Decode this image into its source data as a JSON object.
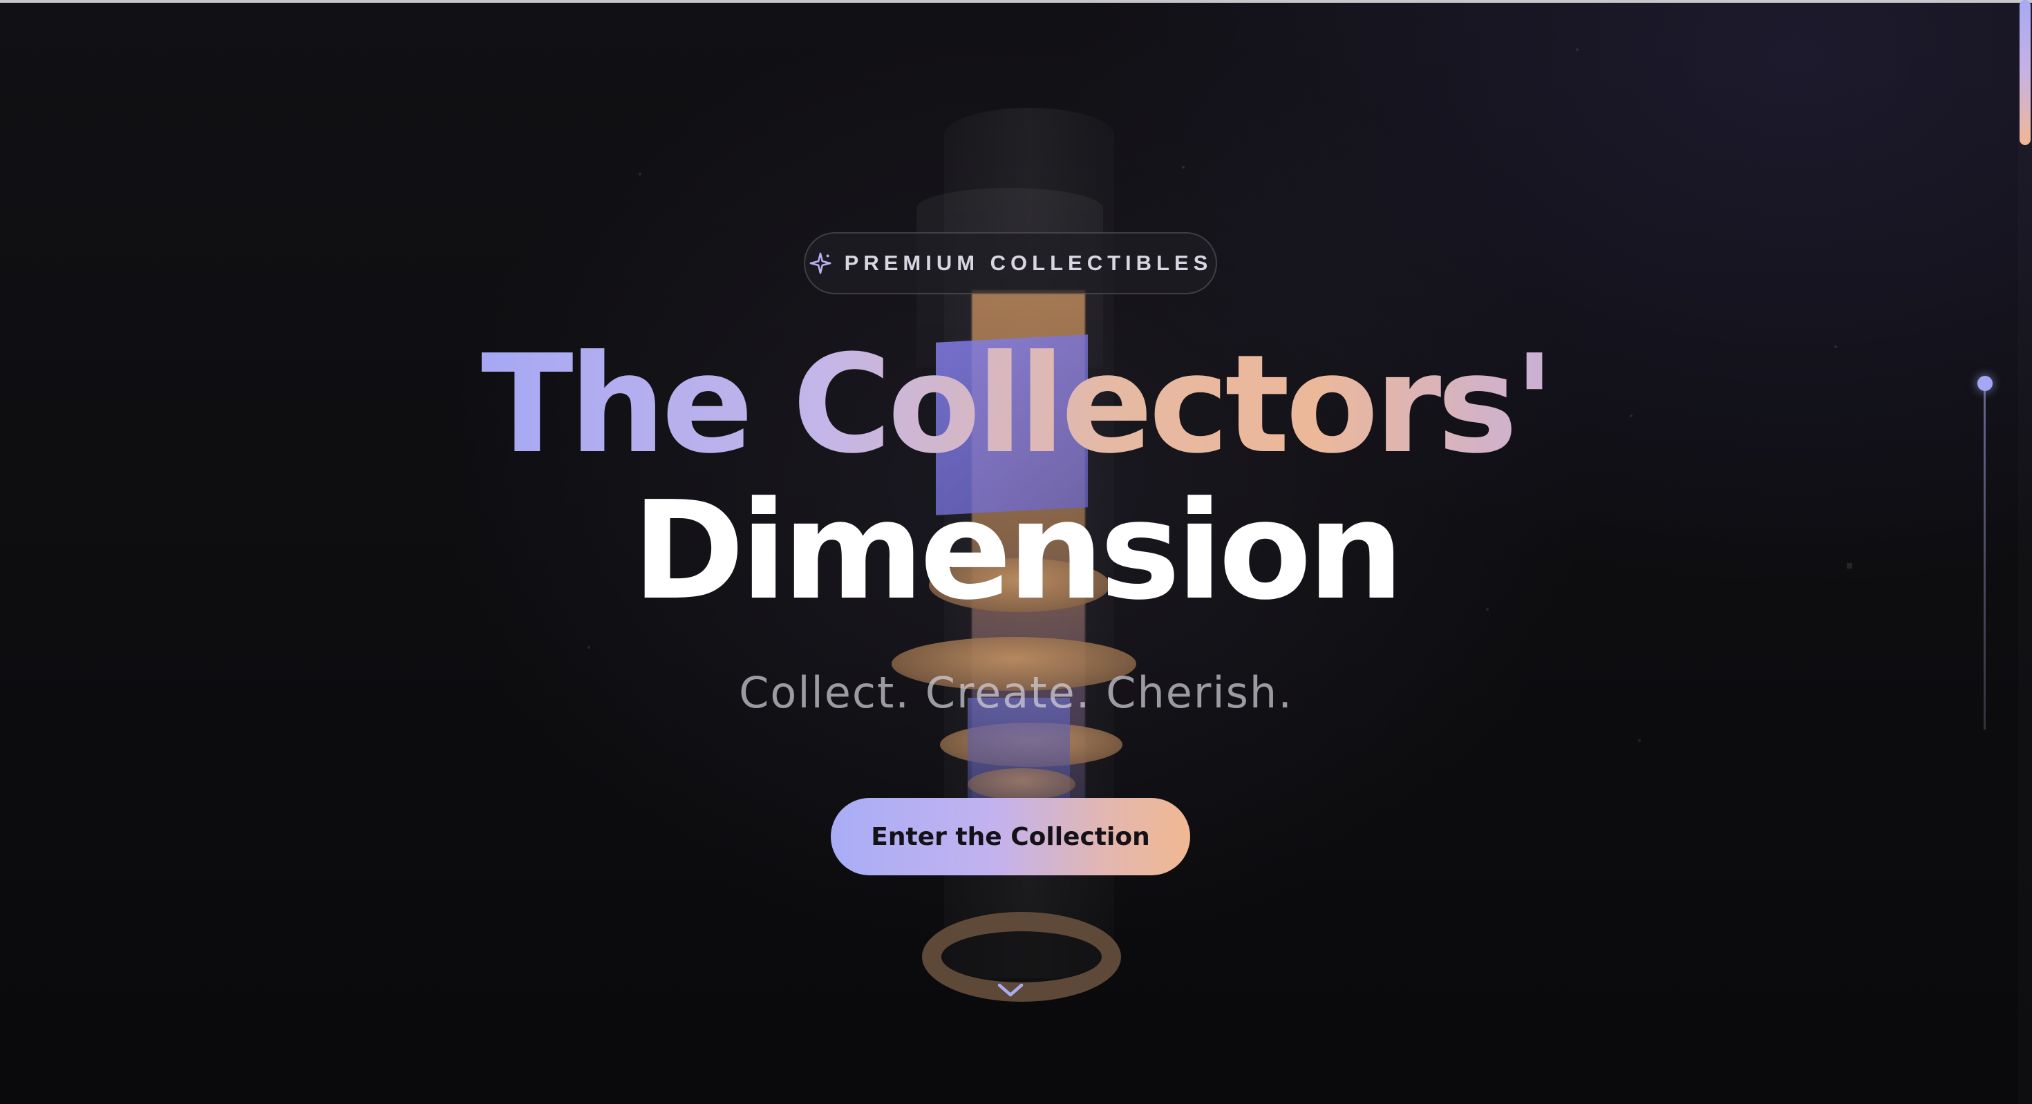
{
  "badge": {
    "icon": "sparkle-icon",
    "label": "PREMIUM COLLECTIBLES"
  },
  "hero": {
    "title_line_1": "The Collectors'",
    "title_line_2": "Dimension",
    "tagline": "Collect. Create. Cherish.",
    "cta_label": "Enter the Collection",
    "scroll_icon": "chevron-down-icon"
  },
  "colors": {
    "background": "#0c0c0f",
    "accent_lavender": "#a6a8f4",
    "accent_peach": "#f0b892",
    "title_white": "#ffffff",
    "button_text": "#141218"
  },
  "nav": {
    "section_indicator_icon": "active-section-dot"
  }
}
